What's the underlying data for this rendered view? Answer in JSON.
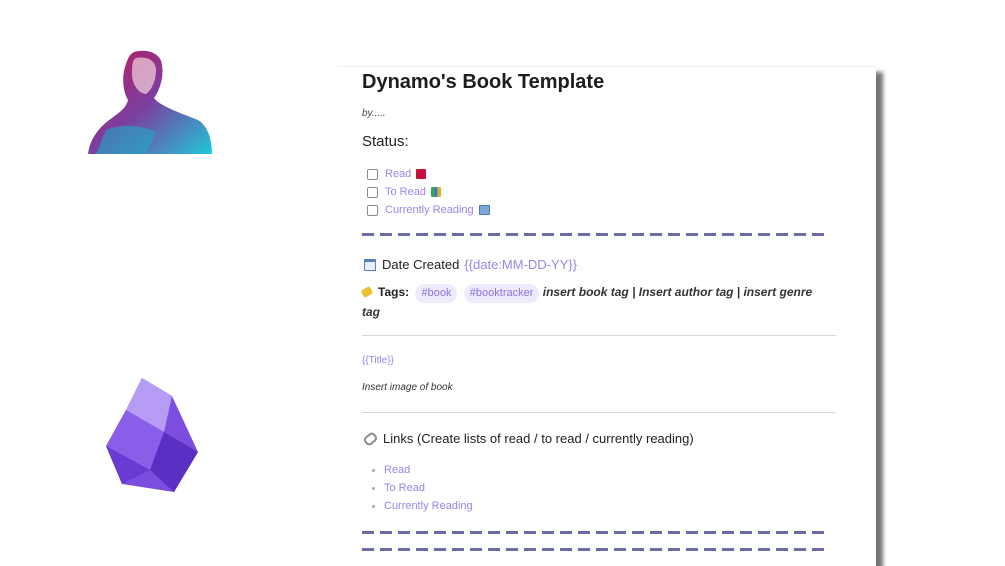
{
  "note": {
    "title": "Dynamo's Book Template",
    "byline": "by.....",
    "status_heading": "Status:",
    "tasks": [
      {
        "label": "Read",
        "emoji": "red-book-icon"
      },
      {
        "label": "To Read",
        "emoji": "books-stack-icon"
      },
      {
        "label": "Currently Reading",
        "emoji": "open-book-icon"
      }
    ],
    "date_label": "Date Created",
    "date_value": "{{date:MM-DD-YY}}",
    "tags_label": "Tags:",
    "tags": [
      "#book",
      "#booktracker"
    ],
    "tags_rest": "insert book tag | Insert author tag | insert genre tag",
    "title_template": "{{Title}}",
    "insert_image": "Insert image of book",
    "links_heading": "Links (Create lists of read / to read / currently reading)",
    "links": [
      "Read",
      "To Read",
      "Currently Reading"
    ]
  },
  "colors": {
    "link": "#9b84e8",
    "tag_bg": "#eeebfc",
    "dash": "#6a6aa8"
  }
}
